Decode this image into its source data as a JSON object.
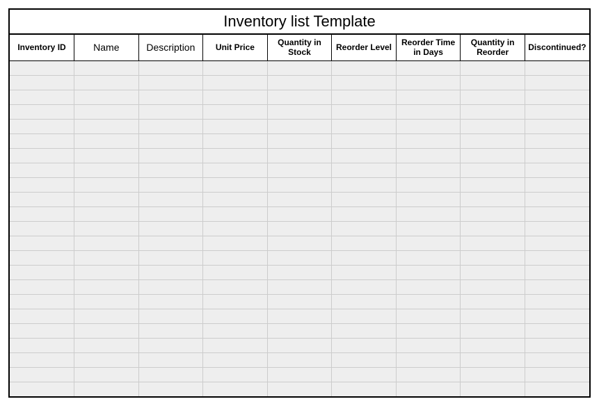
{
  "title": "Inventory list Template",
  "columns": [
    "Inventory ID",
    "Name",
    "Description",
    "Unit Price",
    "Quantity in Stock",
    "Reorder Level",
    "Reorder Time in Days",
    "Quantity in Reorder",
    "Discontinued?"
  ],
  "rows": [
    [
      "",
      "",
      "",
      "",
      "",
      "",
      "",
      "",
      ""
    ],
    [
      "",
      "",
      "",
      "",
      "",
      "",
      "",
      "",
      ""
    ],
    [
      "",
      "",
      "",
      "",
      "",
      "",
      "",
      "",
      ""
    ],
    [
      "",
      "",
      "",
      "",
      "",
      "",
      "",
      "",
      ""
    ],
    [
      "",
      "",
      "",
      "",
      "",
      "",
      "",
      "",
      ""
    ],
    [
      "",
      "",
      "",
      "",
      "",
      "",
      "",
      "",
      ""
    ],
    [
      "",
      "",
      "",
      "",
      "",
      "",
      "",
      "",
      ""
    ],
    [
      "",
      "",
      "",
      "",
      "",
      "",
      "",
      "",
      ""
    ],
    [
      "",
      "",
      "",
      "",
      "",
      "",
      "",
      "",
      ""
    ],
    [
      "",
      "",
      "",
      "",
      "",
      "",
      "",
      "",
      ""
    ],
    [
      "",
      "",
      "",
      "",
      "",
      "",
      "",
      "",
      ""
    ],
    [
      "",
      "",
      "",
      "",
      "",
      "",
      "",
      "",
      ""
    ],
    [
      "",
      "",
      "",
      "",
      "",
      "",
      "",
      "",
      ""
    ],
    [
      "",
      "",
      "",
      "",
      "",
      "",
      "",
      "",
      ""
    ],
    [
      "",
      "",
      "",
      "",
      "",
      "",
      "",
      "",
      ""
    ],
    [
      "",
      "",
      "",
      "",
      "",
      "",
      "",
      "",
      ""
    ],
    [
      "",
      "",
      "",
      "",
      "",
      "",
      "",
      "",
      ""
    ],
    [
      "",
      "",
      "",
      "",
      "",
      "",
      "",
      "",
      ""
    ],
    [
      "",
      "",
      "",
      "",
      "",
      "",
      "",
      "",
      ""
    ],
    [
      "",
      "",
      "",
      "",
      "",
      "",
      "",
      "",
      ""
    ],
    [
      "",
      "",
      "",
      "",
      "",
      "",
      "",
      "",
      ""
    ],
    [
      "",
      "",
      "",
      "",
      "",
      "",
      "",
      "",
      ""
    ],
    [
      "",
      "",
      "",
      "",
      "",
      "",
      "",
      "",
      ""
    ]
  ]
}
